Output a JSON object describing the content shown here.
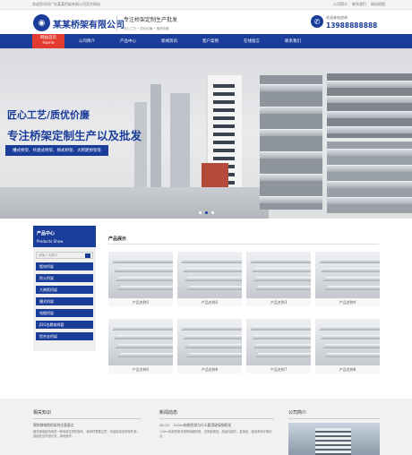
{
  "topbar": {
    "welcome": "欢迎您访问广东某某桥架有限公司官方网站",
    "links": [
      "公司简介",
      "联系我们",
      "网站地图"
    ]
  },
  "header": {
    "logo_text": "某某桥架有限公司",
    "slogan_main": "专注桥架定制生产批发",
    "slogan_sub": "匠心工艺 • 质优价廉 • 值得信赖",
    "hotline_label": "欢迎来电咨询",
    "hotline_number": "13988888888"
  },
  "nav": {
    "home_cn": "网站首页",
    "home_en": "Home",
    "items": [
      "公司简介",
      "产品中心",
      "新闻资讯",
      "客户案例",
      "在线留言",
      "联系我们"
    ]
  },
  "banner": {
    "title1": "匠心工艺/质优价廉",
    "title2": "专注桥架定制生产以及批发",
    "tagline": "槽式桥架、托盘式桥架、梯式桥架、大跨距桥架等",
    "slide_count": 3,
    "active_slide": 2
  },
  "sidebar": {
    "title_cn": "产品中心",
    "title_en": "Products Show",
    "search_placeholder": "请输入关键字",
    "categories": [
      "镀锌桥架",
      "防火桥架",
      "大跨距桥架",
      "槽式桥架",
      "电缆桥架",
      "JDG金属穿线管",
      "铝合金桥架"
    ]
  },
  "products": {
    "title": "产品展示",
    "items": [
      "产品名称1",
      "产品名称2",
      "产品名称3",
      "产品名称4",
      "产品名称5",
      "产品名称6",
      "产品名称7",
      "产品名称8"
    ]
  },
  "footer": {
    "knowledge_title": "相关知识",
    "knowledge_item": "镀锌钢电缆桥架的注意要点",
    "knowledge_text": "镀锌钢电缆桥架是一种电缆支撑的部件，使用时需要注意：安装前检查桥架外观，连接处应牢固可靠，接地良好。",
    "news_title": "新闻动态",
    "news_date": "05-22",
    "news_item": "110kv电缆桥架为什么要用玻璃钢桥架",
    "news_text": "110kv电缆桥架采用玻璃钢材质，具有耐腐蚀、绝缘性能好、重量轻、使用寿命长等优点。",
    "company_title": "公司简介"
  },
  "colors": {
    "brand_blue": "#1b3d9a",
    "accent_red": "#e33b2f"
  }
}
